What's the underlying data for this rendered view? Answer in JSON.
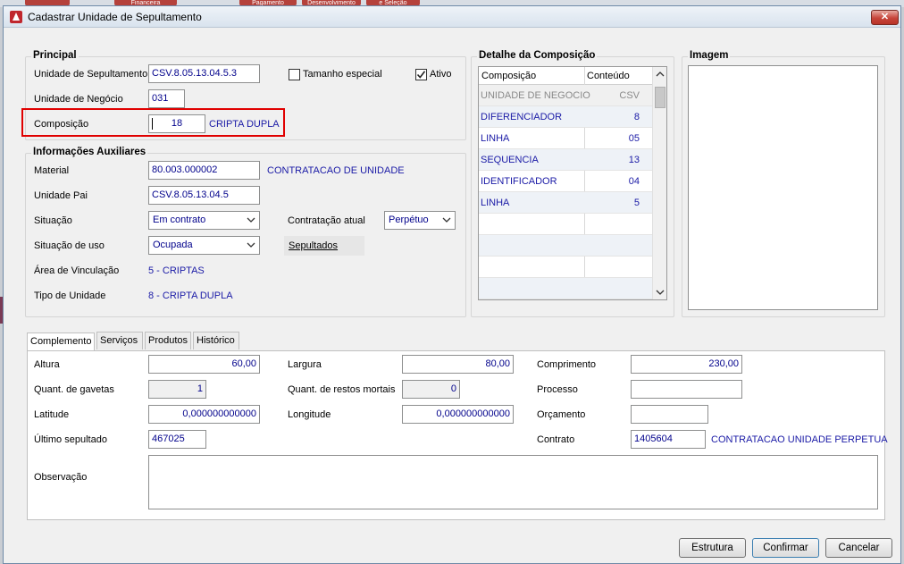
{
  "background": {
    "tiles": [
      "",
      "Financeira",
      "Pagamento",
      "Desenvolvimento",
      "e Seleção"
    ]
  },
  "window": {
    "title": "Cadastrar Unidade de Sepultamento",
    "close_label": "✕"
  },
  "principal": {
    "title": "Principal",
    "unidade_label": "Unidade de Sepultamento",
    "unidade_value": "CSV.8.05.13.04.5.3",
    "tamanho_label": "Tamanho especial",
    "tamanho_checked": false,
    "ativo_label": "Ativo",
    "ativo_checked": true,
    "negocio_label": "Unidade de Negócio",
    "negocio_value": "031",
    "composicao_label": "Composição",
    "composicao_value": "18",
    "composicao_desc": "CRIPTA DUPLA"
  },
  "auxiliares": {
    "title": "Informações Auxiliares",
    "material_label": "Material",
    "material_value": "80.003.000002",
    "material_desc": "CONTRATACAO DE UNIDADE",
    "pai_label": "Unidade Pai",
    "pai_value": "CSV.8.05.13.04.5",
    "situacao_label": "Situação",
    "situacao_value": "Em contrato",
    "contratacao_label": "Contratação atual",
    "contratacao_value": "Perpétuo",
    "uso_label": "Situação de uso",
    "uso_value": "Ocupada",
    "sepultados_label": "Sepultados",
    "area_label": "Área de Vinculação",
    "area_value": "5 - CRIPTAS",
    "tipo_label": "Tipo de Unidade",
    "tipo_value": "8 - CRIPTA DUPLA"
  },
  "detalhe": {
    "title": "Detalhe da Composição",
    "col_composicao": "Composição",
    "col_conteudo": "Conteúdo",
    "rows": [
      {
        "composicao": "UNIDADE DE NEGOCIO",
        "conteudo": "CSV"
      },
      {
        "composicao": "DIFERENCIADOR",
        "conteudo": "8"
      },
      {
        "composicao": "LINHA",
        "conteudo": "05"
      },
      {
        "composicao": "SEQUENCIA",
        "conteudo": "13"
      },
      {
        "composicao": "IDENTIFICADOR",
        "conteudo": "04"
      },
      {
        "composicao": "LINHA",
        "conteudo": "5"
      }
    ]
  },
  "imagem": {
    "title": "Imagem"
  },
  "tabs": [
    "Complemento",
    "Serviços",
    "Produtos",
    "Histórico"
  ],
  "complemento": {
    "altura_label": "Altura",
    "altura_value": "60,00",
    "largura_label": "Largura",
    "largura_value": "80,00",
    "comprimento_label": "Comprimento",
    "comprimento_value": "230,00",
    "gavetas_label": "Quant. de gavetas",
    "gavetas_value": "1",
    "restos_label": "Quant. de restos mortais",
    "restos_value": "0",
    "processo_label": "Processo",
    "processo_value": "",
    "latitude_label": "Latitude",
    "latitude_value": "0,000000000000",
    "longitude_label": "Longitude",
    "longitude_value": "0,000000000000",
    "orcamento_label": "Orçamento",
    "orcamento_value": "",
    "ultimo_label": "Último sepultado",
    "ultimo_value": "467025",
    "contrato_label": "Contrato",
    "contrato_value": "1405604",
    "contrato_desc": "CONTRATACAO UNIDADE PERPETUA",
    "observacao_label": "Observação",
    "observacao_value": ""
  },
  "buttons": {
    "estrutura": "Estrutura",
    "confirmar": "Confirmar",
    "cancelar": "Cancelar"
  },
  "colors": {
    "highlight": "#e00000",
    "value_text": "#00008b",
    "close_button": "#c7453a"
  }
}
